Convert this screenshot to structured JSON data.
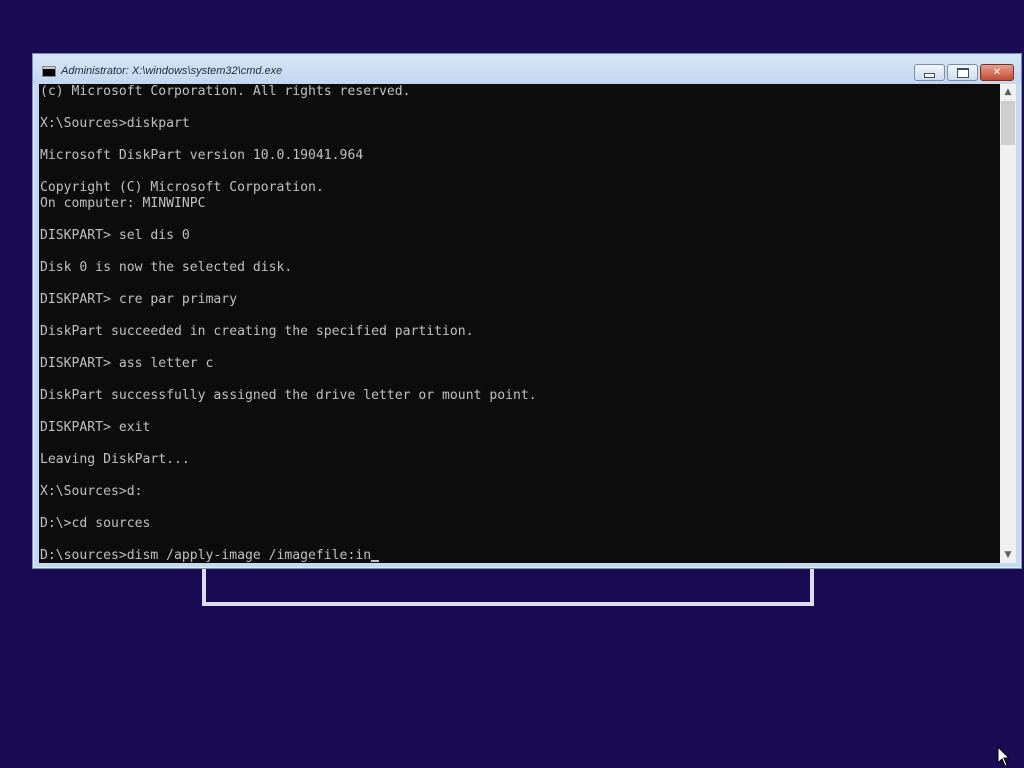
{
  "window": {
    "title": "Administrator: X:\\windows\\system32\\cmd.exe",
    "min_label": "",
    "max_label": "",
    "close_label": "✕"
  },
  "console": {
    "lines": [
      "(c) Microsoft Corporation. All rights reserved.",
      "",
      "X:\\Sources>diskpart",
      "",
      "Microsoft DiskPart version 10.0.19041.964",
      "",
      "Copyright (C) Microsoft Corporation.",
      "On computer: MINWINPC",
      "",
      "DISKPART> sel dis 0",
      "",
      "Disk 0 is now the selected disk.",
      "",
      "DISKPART> cre par primary",
      "",
      "DiskPart succeeded in creating the specified partition.",
      "",
      "DISKPART> ass letter c",
      "",
      "DiskPart successfully assigned the drive letter or mount point.",
      "",
      "DISKPART> exit",
      "",
      "Leaving DiskPart...",
      "",
      "X:\\Sources>d:",
      "",
      "D:\\>cd sources",
      "",
      "D:\\sources>dism /apply-image /imagefile:in"
    ]
  },
  "scrollbar": {
    "up_glyph": "▲",
    "down_glyph": "▼"
  },
  "colors": {
    "desktop_background": "#1b0a54",
    "console_background": "#0c0c0c",
    "console_text": "#c0c0c0"
  }
}
